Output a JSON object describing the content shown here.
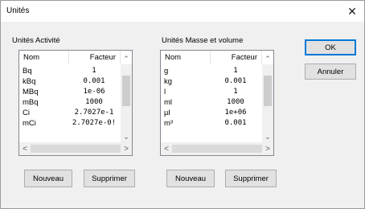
{
  "window": {
    "title": "Unités"
  },
  "activity": {
    "label": "Unités Activité",
    "columns": [
      "Nom",
      "Facteur"
    ],
    "rows": [
      [
        "Bq",
        "1"
      ],
      [
        "kBq",
        "0.001"
      ],
      [
        "MBq",
        "1e-06"
      ],
      [
        "mBq",
        "1000"
      ],
      [
        "Ci",
        "2.7027e-1"
      ],
      [
        "mCi",
        "2.7027e-0!"
      ]
    ],
    "new_label": "Nouveau",
    "delete_label": "Supprimer"
  },
  "mass": {
    "label": "Unités Masse et volume",
    "columns": [
      "Nom",
      "Facteur"
    ],
    "rows": [
      [
        "g",
        "1"
      ],
      [
        "kg",
        "0.001"
      ],
      [
        "l",
        "1"
      ],
      [
        "ml",
        "1000"
      ],
      [
        "µl",
        "1e+06"
      ],
      [
        "m³",
        "0.001"
      ]
    ],
    "new_label": "Nouveau",
    "delete_label": "Supprimer"
  },
  "buttons": {
    "ok": "OK",
    "cancel": "Annuler"
  }
}
